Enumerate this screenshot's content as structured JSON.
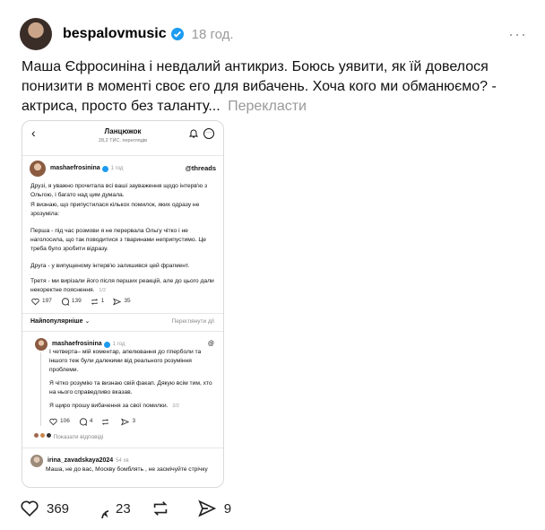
{
  "post": {
    "username": "bespalovmusic",
    "time": "18 год.",
    "more": "···",
    "caption": "Маша Єфросиніна і невдалий антикриз. Боюсь уявити, як їй довелося понизити в моменті своє его для вибачень. Хоча кого ми обманюємо? - актриса, просто без таланту...",
    "translate": "Перекласти",
    "actions": {
      "likes": "369",
      "comments": "23",
      "reposts": "",
      "shares": "9"
    }
  },
  "screenshot": {
    "back": "‹",
    "title": "Ланцюжок",
    "subtitle": "28,2 ТИС. переглядів",
    "author": "mashaefrosinina",
    "time": "1 год",
    "brand": "@threads",
    "paragraphs": [
      "Друзі, я уважно прочитала всі ваші зауваження щодо інтерв'ю з Ольгою, і багато над цим думала.",
      "Я визнаю, що припустилася кількох помилок, яких одразу не зрозуміла:",
      "Перша - під час розмови я не перервала Ольгу чітко і не наголосила, що так поводитися з тваринами неприпустимо. Це треба було зробити відразу.",
      "Друга - у випущеному інтерв'ю залишився цей фрагмент.",
      "Третя - ми вирізали його після перших реакцій, але до цього дали некоректне пояснення."
    ],
    "pager": "1/2",
    "stats": {
      "likes": "197",
      "comments": "139",
      "reposts": "1",
      "shares": "35"
    },
    "sort_label": "Найпопулярніше",
    "sort_link": "Переглянути дії",
    "reply": {
      "author": "mashaefrosinina",
      "time": "1 год",
      "paragraphs": [
        "І четверта– мій коментар, апелювання до гіперболи та іншого теж були далекими від реального розуміння проблеми.",
        "Я чітко розумію та визнаю свій факап. Дякую всім тим, хто на нього справедливо вказав.",
        "Я щиро прошу вибачення за свої помилки."
      ],
      "pager": "2/2",
      "stats": {
        "likes": "106",
        "comments": "4",
        "reposts": "",
        "shares": "3"
      },
      "show_replies": "Показати відповіді"
    },
    "comment": {
      "author": "irina_zavadskaya2024",
      "time": "54 хв",
      "text": "Маша, не до вас, Москву бомблять , не засмічуйте стрічку"
    }
  }
}
